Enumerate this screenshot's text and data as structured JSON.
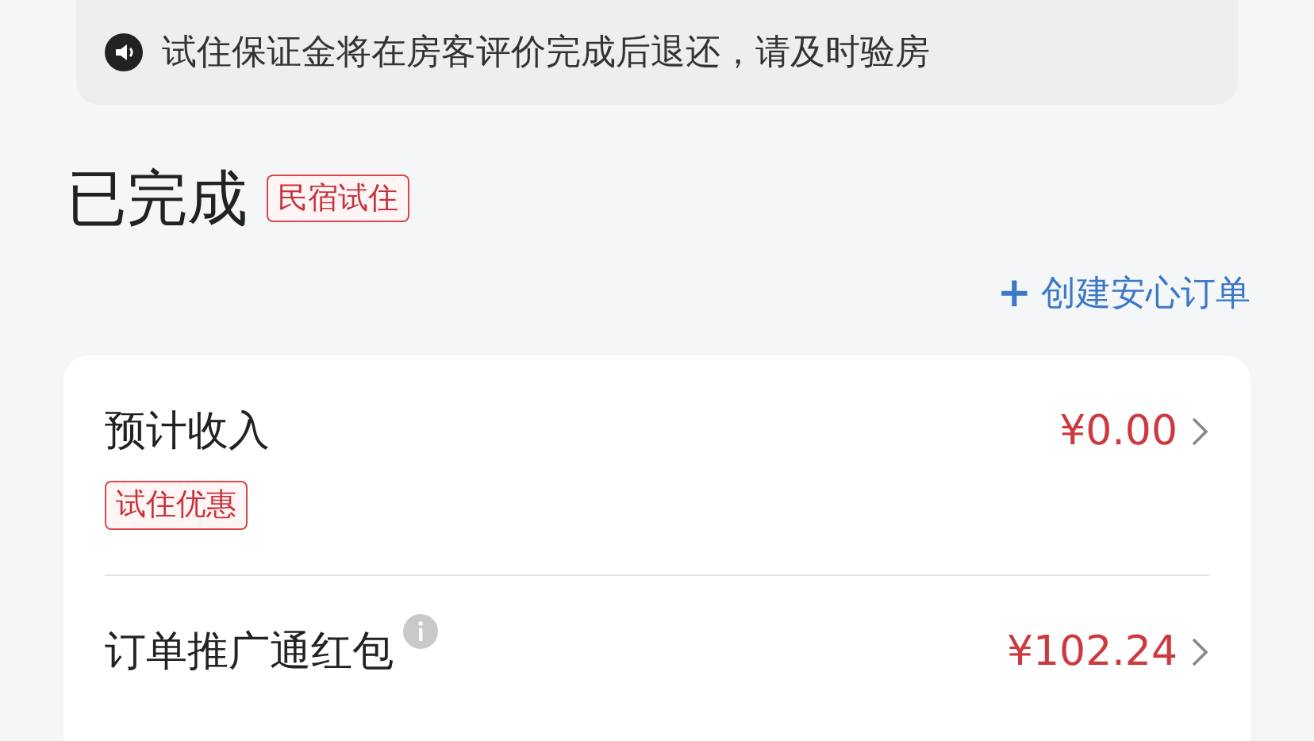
{
  "notice": {
    "text": "试住保证金将在房客评价完成后退还，请及时验房"
  },
  "status": {
    "title": "已完成",
    "tag": "民宿试住"
  },
  "create_link": {
    "icon": "+",
    "label": "创建安心订单"
  },
  "income_rows": [
    {
      "label": "预计收入",
      "amount": "¥0.00",
      "tag": "试住优惠",
      "info": false
    },
    {
      "label": "订单推广通红包",
      "amount": "¥102.24",
      "info": true
    }
  ]
}
